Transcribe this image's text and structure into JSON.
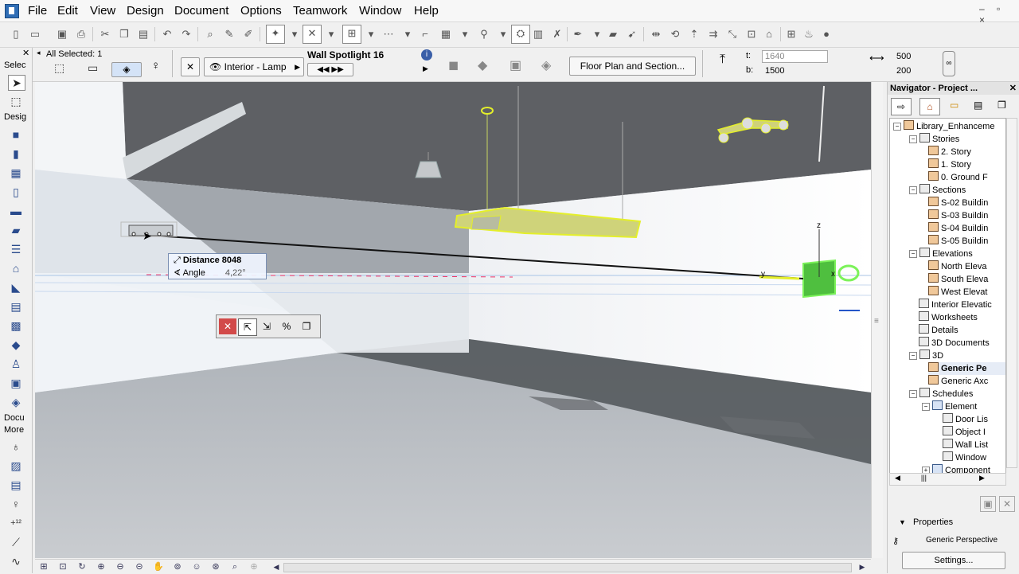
{
  "menu": [
    "File",
    "Edit",
    "View",
    "Design",
    "Document",
    "Options",
    "Teamwork",
    "Window",
    "Help"
  ],
  "window_controls": "– ▫ ×",
  "infobox": {
    "selection_label": "All Selected: 1",
    "layer": "Interior - Lamp",
    "object_name": "Wall Spotlight 16",
    "floor_plan_button": "Floor Plan and Section...",
    "t_label": "t:",
    "t_value": "1640",
    "b_label": "b:",
    "b_value": "1500",
    "width_value": "500",
    "height_value": "200"
  },
  "toolbox": {
    "select_label": "Selec",
    "design_label": "Desig",
    "document_label": "Docu",
    "more_label": "More"
  },
  "tracker": {
    "distance_label": "Distance",
    "distance_value": "8048",
    "angle_label": "Angle",
    "angle_value": "4,22°"
  },
  "axes": {
    "z": "z",
    "y": "y",
    "x": "x"
  },
  "navigator": {
    "title": "Navigator - Project ...",
    "tree": [
      {
        "label": "Library_Enhanceme",
        "level": 0
      },
      {
        "label": "Stories",
        "level": 1
      },
      {
        "label": "2. Story",
        "level": 2
      },
      {
        "label": "1. Story",
        "level": 2
      },
      {
        "label": "0. Ground F",
        "level": 2
      },
      {
        "label": "Sections",
        "level": 1
      },
      {
        "label": "S-02 Buildin",
        "level": 2
      },
      {
        "label": "S-03 Buildin",
        "level": 2
      },
      {
        "label": "S-04 Buildin",
        "level": 2
      },
      {
        "label": "S-05 Buildin",
        "level": 2
      },
      {
        "label": "Elevations",
        "level": 1
      },
      {
        "label": "North Eleva",
        "level": 2
      },
      {
        "label": "South Eleva",
        "level": 2
      },
      {
        "label": "West Elevat",
        "level": 2
      },
      {
        "label": "Interior Elevatic",
        "level": 1
      },
      {
        "label": "Worksheets",
        "level": 1
      },
      {
        "label": "Details",
        "level": 1
      },
      {
        "label": "3D Documents",
        "level": 1
      },
      {
        "label": "3D",
        "level": 1
      },
      {
        "label": "Generic Pe",
        "level": 2,
        "selected": true
      },
      {
        "label": "Generic Axc",
        "level": 2
      },
      {
        "label": "Schedules",
        "level": 1
      },
      {
        "label": "Element",
        "level": 2
      },
      {
        "label": "Door Lis",
        "level": 3
      },
      {
        "label": "Object I",
        "level": 3
      },
      {
        "label": "Wall List",
        "level": 3
      },
      {
        "label": "Window",
        "level": 3
      },
      {
        "label": "Component",
        "level": 2
      }
    ],
    "properties_label": "Properties",
    "properties_value": "Generic Perspective",
    "settings_button": "Settings..."
  }
}
